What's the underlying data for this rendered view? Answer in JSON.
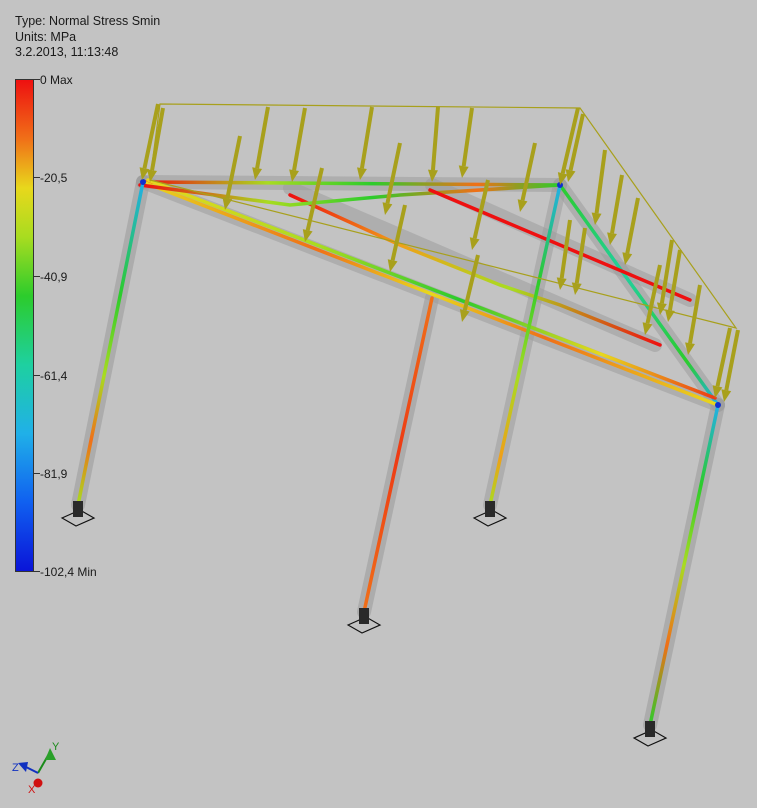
{
  "info": {
    "type_line": "Type: Normal Stress Smin",
    "units_line": "Units: MPa",
    "date_line": "3.2.2013, 11:13:48"
  },
  "legend": {
    "ticks": [
      "0 Max",
      "-20,5",
      "-40,9",
      "-61,4",
      "-81,9",
      "-102,4 Min"
    ],
    "colors": [
      "#ee1010",
      "#e8d81c",
      "#2ccc2c",
      "#20b0e8",
      "#0a14d8"
    ]
  },
  "triad": {
    "x": "X",
    "y": "Y",
    "z": "Z"
  },
  "colors": {
    "background": "#c3c3c3",
    "beam": "#9d9d9d",
    "load_arrow": "#a8a01c",
    "support": "#2a2a2a"
  }
}
